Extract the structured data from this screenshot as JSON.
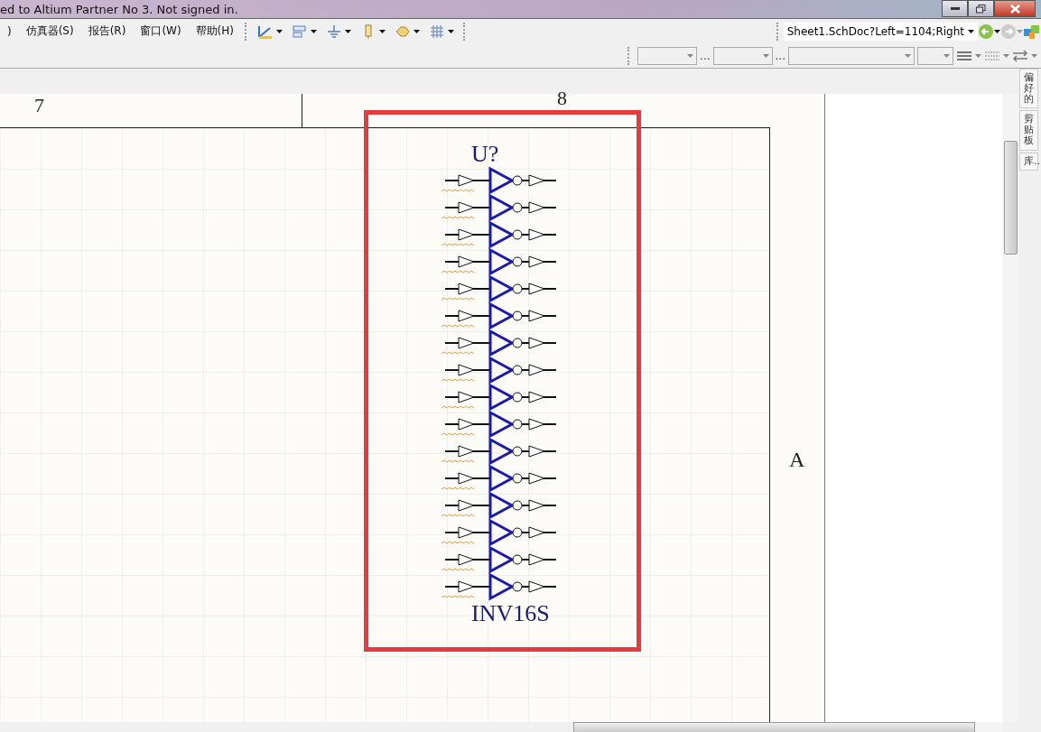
{
  "window": {
    "title": "ed to Altium Partner No 3. Not signed in."
  },
  "menu": [
    {
      "label": ")"
    },
    {
      "label": "仿真器(S)"
    },
    {
      "label": "报告(R)"
    },
    {
      "label": "窗口(W)"
    },
    {
      "label": "帮助(H)"
    }
  ],
  "address": {
    "value": "Sheet1.SchDoc?Left=1104;Right"
  },
  "format_bar": {
    "separators": [
      "...",
      "..."
    ]
  },
  "side_tabs": [
    {
      "label": "偏好的"
    },
    {
      "label": "剪贴板"
    },
    {
      "label": "库..."
    }
  ],
  "sheet": {
    "zones": [
      {
        "label": "7"
      },
      {
        "label": "8"
      }
    ],
    "row_label": "A"
  },
  "component": {
    "designator": "U?",
    "comment": "INV16S"
  }
}
